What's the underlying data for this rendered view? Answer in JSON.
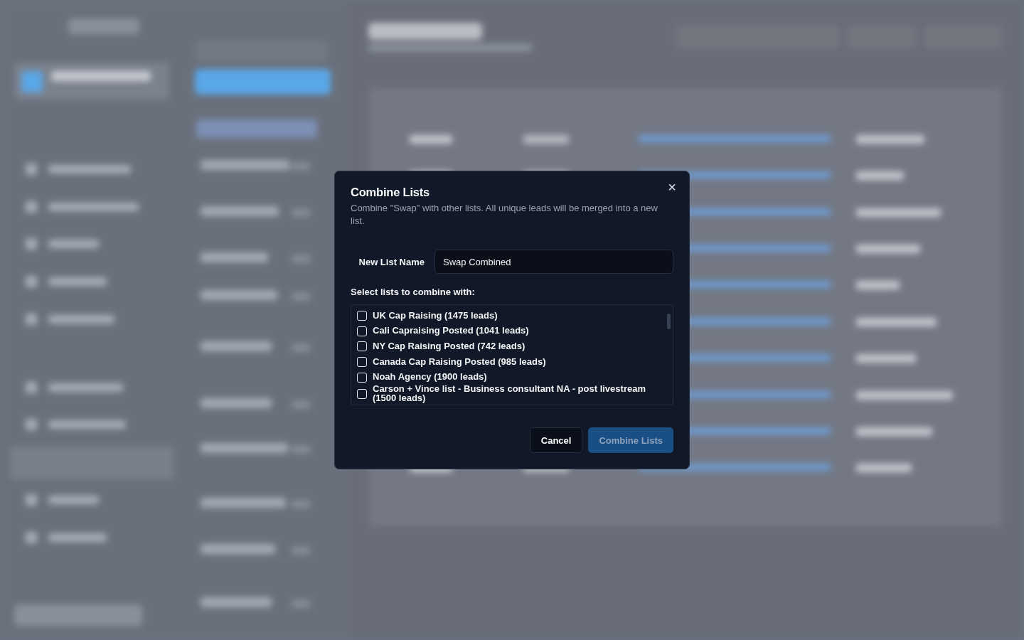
{
  "dialog": {
    "title": "Combine Lists",
    "description": "Combine \"Swap\" with other lists. All unique leads will be merged into a new list.",
    "close": "×",
    "name_field": {
      "label": "New List Name",
      "value": "Swap Combined"
    },
    "lists_label": "Select lists to combine with:",
    "lists": [
      {
        "label": "UK Cap Raising (1475 leads)",
        "checked": false
      },
      {
        "label": "Cali Capraising Posted (1041 leads)",
        "checked": false
      },
      {
        "label": "NY Cap Raising Posted (742 leads)",
        "checked": false
      },
      {
        "label": "Canada Cap Raising Posted (985 leads)",
        "checked": false
      },
      {
        "label": "Noah Agency (1900 leads)",
        "checked": false
      },
      {
        "label": "Carson + Vince list - Business consultant NA - post livestream (1500 leads)",
        "checked": false
      }
    ],
    "buttons": [
      {
        "kind": "secondary",
        "label": "Cancel",
        "disabled": false
      },
      {
        "kind": "primary",
        "label": "Combine Lists",
        "disabled": true
      }
    ]
  }
}
